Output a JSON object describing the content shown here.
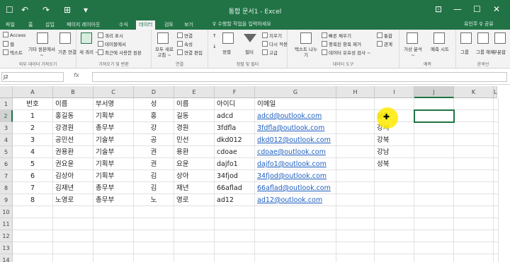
{
  "window": {
    "title": "통합 문서1 - Excel",
    "quick_access": [
      "↶",
      "↷",
      "☐",
      "⊞",
      "▾"
    ],
    "controls": {
      "ribbon_options": "⊡",
      "minimize": "—",
      "maximize": "☐",
      "close": "✕"
    }
  },
  "tabs": [
    "파일",
    "홈",
    "삽입",
    "페이지 레이아웃",
    "수식",
    "데이터",
    "검토",
    "보기"
  ],
  "active_tab": "데이터",
  "tell_me": "♀ 수행할 작업을 입력하세요",
  "user": "유인주 ♀ 공유",
  "ribbon": {
    "get_external": {
      "items": [
        "Access",
        "웹",
        "텍스트"
      ],
      "other": "기타 원본에서 ~",
      "existing": "기존 연결",
      "label": "외부 데이터 가져오기"
    },
    "get_transform": {
      "new_query": "새 쿼리 ~",
      "items": [
        "쿼리 표시",
        "테이블에서",
        "최근에 사용한 원본"
      ],
      "label": "가져오기 및 변환"
    },
    "connections": {
      "refresh": "모두 새로 고침 ~",
      "items": [
        "연결",
        "속성",
        "연결 편집"
      ],
      "label": "연결"
    },
    "sort_filter": {
      "sort": "정렬",
      "filter": "필터",
      "items": [
        "지우기",
        "다시 적용",
        "고급"
      ],
      "label": "정렬 및 필터"
    },
    "data_tools": {
      "text_to_columns": "텍스트 나누기",
      "items": [
        "빠른 채우기",
        "중복된 항목 제거",
        "데이터 유효성 검사 ~"
      ],
      "items2": [
        "통합",
        "관계"
      ],
      "label": "데이터 도구"
    },
    "forecast": {
      "what_if": "가상 분석 ~",
      "sheet": "예측 시트",
      "label": "예측"
    },
    "outline": {
      "items": [
        "그룹",
        "그룹 해제",
        "부분합"
      ],
      "label": "윤곽선"
    }
  },
  "formula_bar": {
    "name_box": "J2",
    "fx": "fx",
    "value": ""
  },
  "columns": [
    "A",
    "B",
    "C",
    "D",
    "E",
    "F",
    "G",
    "H",
    "I",
    "J",
    "K",
    "L"
  ],
  "selected_column": "J",
  "selected_row": "2",
  "rows": [
    [
      "번호",
      "이름",
      "부서명",
      "성",
      "이름",
      "아이디",
      "이메일",
      "",
      "",
      "",
      "",
      ""
    ],
    [
      "1",
      "홍길동",
      "기획부",
      "홍",
      "길동",
      "adcd",
      "adcd@outlook.com",
      "",
      "성동",
      "",
      "",
      ""
    ],
    [
      "2",
      "강경원",
      "총무부",
      "강",
      "경원",
      "3fdfla",
      "3fdfla@outlook.com",
      "",
      "강서",
      "",
      "",
      ""
    ],
    [
      "3",
      "공민선",
      "기술부",
      "공",
      "민선",
      "dkd012",
      "dkd012@outlook.com",
      "",
      "강북",
      "",
      "",
      ""
    ],
    [
      "4",
      "권용환",
      "기술부",
      "권",
      "용환",
      "cdoae",
      "cdoae@outlook.com",
      "",
      "강남",
      "",
      "",
      ""
    ],
    [
      "5",
      "권요윤",
      "기획부",
      "권",
      "요윤",
      "dajfo1",
      "dajfo1@outlook.com",
      "",
      "성북",
      "",
      "",
      ""
    ],
    [
      "6",
      "김상아",
      "기획부",
      "김",
      "상아",
      "34fjod",
      "34fjod@outlook.com",
      "",
      "",
      "",
      "",
      ""
    ],
    [
      "7",
      "김재년",
      "총무부",
      "김",
      "재년",
      "66aflad",
      "66aflad@outlook.com",
      "",
      "",
      "",
      "",
      ""
    ],
    [
      "8",
      "노영로",
      "총무부",
      "노",
      "영로",
      "ad12",
      "ad12@outlook.com",
      "",
      "",
      "",
      "",
      ""
    ],
    [
      "",
      "",
      "",
      "",
      "",
      "",
      "",
      "",
      "",
      "",
      "",
      ""
    ],
    [
      "",
      "",
      "",
      "",
      "",
      "",
      "",
      "",
      "",
      "",
      "",
      ""
    ],
    [
      "",
      "",
      "",
      "",
      "",
      "",
      "",
      "",
      "",
      "",
      "",
      ""
    ],
    [
      "",
      "",
      "",
      "",
      "",
      "",
      "",
      "",
      "",
      "",
      "",
      ""
    ],
    [
      "",
      "",
      "",
      "",
      "",
      "",
      "",
      "",
      "",
      "",
      "",
      ""
    ]
  ],
  "colors": {
    "excel_green": "#217346",
    "link": "#1f5fbf",
    "highlight": "#ffeb00"
  }
}
